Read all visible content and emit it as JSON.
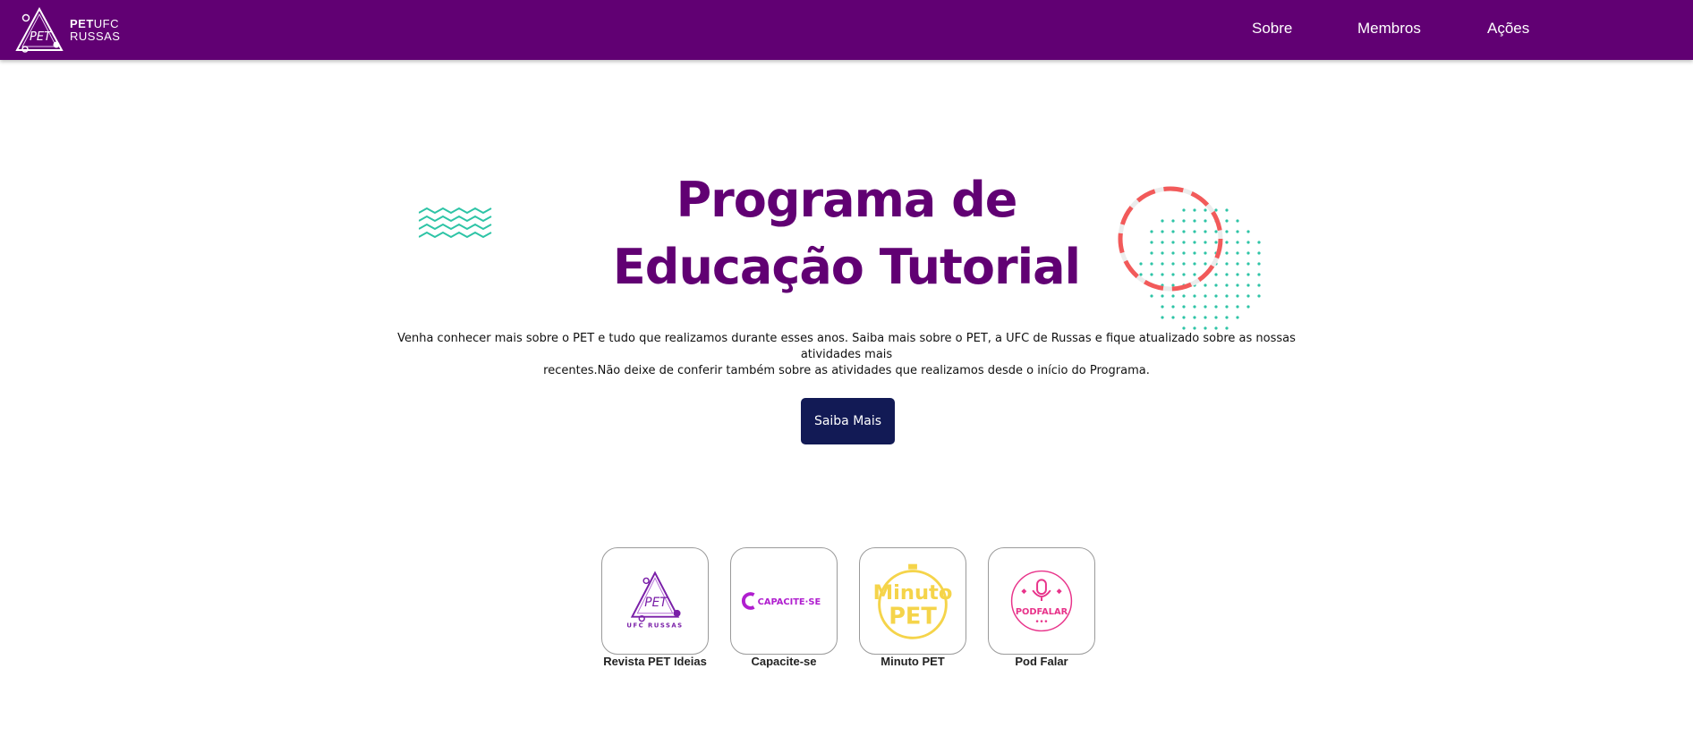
{
  "header": {
    "brand_bold": "PET",
    "brand_line1_rest": "UFC",
    "brand_line2": "RUSSAS",
    "nav": [
      {
        "label": "Sobre"
      },
      {
        "label": "Membros"
      },
      {
        "label": "Ações"
      }
    ]
  },
  "hero": {
    "title_line1": "Programa de",
    "title_line2": "Educação Tutorial",
    "description_line1": "Venha conhecer mais sobre o PET e tudo que realizamos durante esses anos. Saiba mais sobre o PET, a UFC de Russas e fique atualizado sobre as nossas atividades mais",
    "description_line2": "recentes.Não deixe de conferir também sobre as atividades que realizamos desde o início do Programa.",
    "cta_label": "Saiba Mais"
  },
  "projects": [
    {
      "label": "Revista PET Ideias",
      "logo_text": "PET",
      "logo_subtext": "UFC RUSSAS"
    },
    {
      "label": "Capacite-se",
      "logo_text": "CAPACITE·SE"
    },
    {
      "label": "Minuto PET",
      "logo_text": "Minuto",
      "logo_subtext": "PET"
    },
    {
      "label": "Pod Falar",
      "logo_text": "PODFALAR"
    }
  ],
  "colors": {
    "primary": "#610073",
    "cta": "#121a55",
    "accent_teal": "#2ec4a6",
    "accent_coral": "#f25a5a",
    "capacite": "#b01fcf",
    "minuto": "#f5d44a",
    "podfalar": "#e8338a"
  }
}
